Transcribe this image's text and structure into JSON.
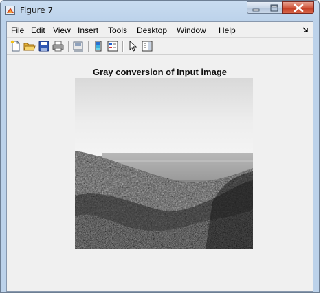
{
  "window": {
    "title": "Figure 7",
    "app_icon": "matlab-figure-icon",
    "controls": [
      "minimize-icon",
      "maximize-icon",
      "close-icon"
    ]
  },
  "menubar": {
    "items": [
      {
        "mnemonic": "F",
        "rest": "ile"
      },
      {
        "mnemonic": "E",
        "rest": "dit"
      },
      {
        "mnemonic": "V",
        "rest": "iew"
      },
      {
        "mnemonic": "I",
        "rest": "nsert"
      },
      {
        "mnemonic": "T",
        "rest": "ools"
      },
      {
        "mnemonic": "D",
        "rest": "esktop"
      },
      {
        "mnemonic": "W",
        "rest": "indow"
      },
      {
        "mnemonic": "H",
        "rest": "elp"
      }
    ],
    "overflow_icon": "menu-arrow-icon"
  },
  "toolbar": {
    "buttons": [
      "new-figure-icon",
      "open-file-icon",
      "save-figure-icon",
      "print-figure-icon",
      "link-plot-icon",
      "insert-colorbar-icon",
      "insert-legend-icon",
      "edit-plot-icon",
      "show-plot-tools-icon"
    ]
  },
  "figure": {
    "title": "Gray conversion of Input image",
    "image": "grayscale-landscape-photo"
  }
}
